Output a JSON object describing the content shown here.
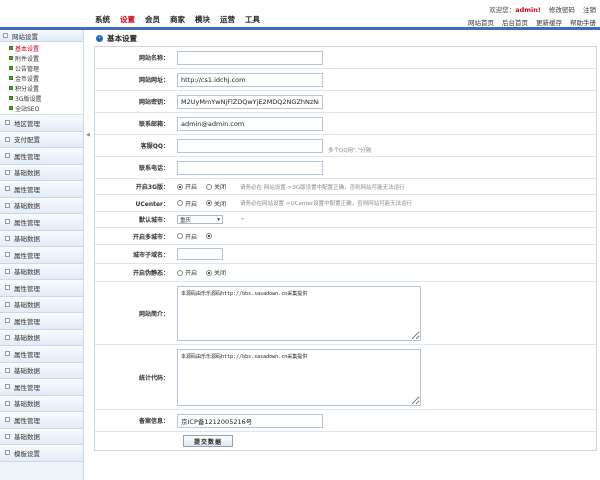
{
  "nav": {
    "items": [
      "系统",
      "设置",
      "会员",
      "商家",
      "模块",
      "运营",
      "工具"
    ],
    "active_index": 1
  },
  "header": {
    "welcome_prefix": "欢迎您：",
    "username": "admin!",
    "change_password": "修改密码",
    "logout": "注销",
    "quick_links": [
      "网站首页",
      "后台首页",
      "更新缓存",
      "帮助手册"
    ]
  },
  "sidebar": {
    "head": "网站设置",
    "sub_items": [
      "基本设置",
      "附件设置",
      "公告管理",
      "金币设置",
      "积分设置",
      "3G版设置",
      "全站SEO"
    ],
    "active_sub": 0,
    "groups": [
      "地区管理",
      "支付配置",
      "属性管理",
      "基础数据",
      "属性管理",
      "基础数据",
      "属性管理",
      "基础数据",
      "属性管理",
      "基础数据",
      "属性管理",
      "基础数据",
      "属性管理",
      "基础数据",
      "属性管理",
      "基础数据",
      "属性管理",
      "基础数据",
      "属性管理",
      "基础数据",
      "模板设置"
    ]
  },
  "panel": {
    "title": "基本设置"
  },
  "form": {
    "site_name_label": "网站名称：",
    "site_name_value": "",
    "site_url_label": "网站网址：",
    "site_url_value": "http://cs1.idchj.com",
    "site_key_label": "网站密钥：",
    "site_key_value": "M2UyMmYwNjFlZDQwYjE2MDQ2NGZhNzNmMTEzY",
    "email_label": "联系邮箱：",
    "email_value": "admin@admin.com",
    "qq_label": "客服QQ：",
    "qq_value": "",
    "qq_hint": "多个QQ用\",\"分隔",
    "phone_label": "联系电话：",
    "phone_value": "",
    "g3_label": "开启3G版：",
    "g3_on": "开启",
    "g3_off": "关闭",
    "g3_hint": "请务必在 网站设置->3G版设置中配置正确，否则网站可能无法运行",
    "uc_label": "UCenter：",
    "uc_on": "开启",
    "uc_off": "关闭",
    "uc_hint": "请务必在网站设置->UCenter设置中配置正确，否则网站可能无法运行",
    "city_label": "默认城市：",
    "city_value": "重庆",
    "multicity_label": "开启多城市：",
    "multicity_on": "开启",
    "multicity_suffix": "",
    "subdomain_label": "城市子域名：",
    "subdomain_value": "",
    "static_label": "开启伪静态：",
    "static_on": "开启",
    "static_off": "关闭",
    "intro_label": "网站简介：",
    "intro_value": "本源码由乐乐源码http://bbs.sasadown.cn采集提供",
    "stats_label": "统计代码：",
    "stats_value": "本源码由乐乐源码http://bbs.sasadown.cn采集提供",
    "icp_label": "备案信息：",
    "icp_value": "京ICP备1212005216号",
    "submit_label": "提交数据"
  }
}
